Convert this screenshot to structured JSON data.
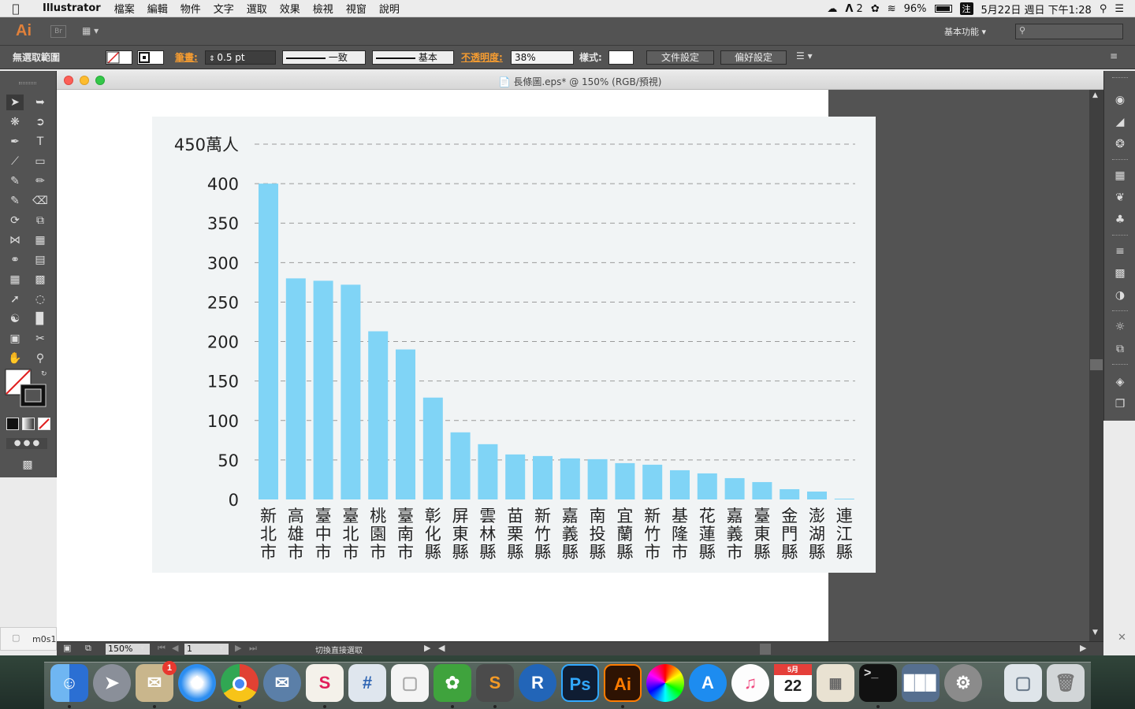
{
  "menubar": {
    "app_name": "Illustrator",
    "menus": [
      "檔案",
      "編輯",
      "物件",
      "文字",
      "選取",
      "效果",
      "檢視",
      "視窗",
      "說明"
    ],
    "adobe_count": "2",
    "battery": "96%",
    "input_method": "注",
    "datetime": "5月22日 週日 下午1:28"
  },
  "appbar": {
    "logo": "Ai",
    "bridge_label": "Br",
    "workspace": "基本功能"
  },
  "control_bar": {
    "selection_label": "無選取範圍",
    "stroke_label": "筆畫:",
    "stroke_value": "0.5 pt",
    "profile_value": "一致",
    "brush_value": "基本",
    "opacity_label": "不透明度:",
    "opacity_value": "38%",
    "style_label": "樣式:",
    "doc_setup_button": "文件設定",
    "prefs_button": "偏好設定"
  },
  "document": {
    "title": "長條圖.eps* @ 150% (RGB/預視)",
    "zoom": "150%",
    "page": "1",
    "status": "切換直接選取",
    "minimized_tab": "m0s1"
  },
  "chart_data": {
    "type": "bar",
    "ylabel": "450萬人",
    "ylim": [
      0,
      450
    ],
    "yticks": [
      0,
      50,
      100,
      150,
      200,
      250,
      300,
      350,
      400
    ],
    "grid": true,
    "bar_color": "#80d4f6",
    "categories": [
      "新北市",
      "高雄市",
      "臺中市",
      "臺北市",
      "桃園市",
      "臺南市",
      "彰化縣",
      "屏東縣",
      "雲林縣",
      "苗栗縣",
      "新竹縣",
      "嘉義縣",
      "南投縣",
      "宜蘭縣",
      "新竹市",
      "基隆市",
      "花蓮縣",
      "嘉義市",
      "臺東縣",
      "金門縣",
      "澎湖縣",
      "連江縣"
    ],
    "values": [
      400,
      280,
      277,
      272,
      213,
      190,
      129,
      85,
      70,
      57,
      55,
      52,
      51,
      46,
      44,
      37,
      33,
      27,
      22,
      13,
      10,
      1
    ]
  },
  "dock": {
    "calendar_month": "5月",
    "calendar_day": "22",
    "mail_badge": "1",
    "ps_label": "Ps",
    "ai_label": "Ai",
    "r_label": "R"
  }
}
